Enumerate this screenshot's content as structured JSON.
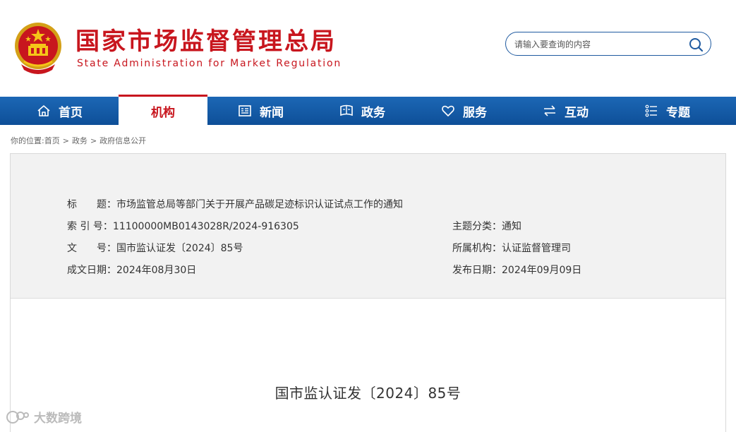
{
  "header": {
    "title": "国家市场监督管理总局",
    "subtitle": "State Administration for Market Regulation",
    "search_placeholder": "请输入要查询的内容"
  },
  "nav": {
    "items": [
      {
        "label": "首页",
        "icon": "home-icon"
      },
      {
        "label": "机构",
        "icon": "",
        "active": true
      },
      {
        "label": "新闻",
        "icon": "news-icon"
      },
      {
        "label": "政务",
        "icon": "government-affairs-icon"
      },
      {
        "label": "服务",
        "icon": "heart-icon"
      },
      {
        "label": "互动",
        "icon": "exchange-arrows-icon"
      },
      {
        "label": "专题",
        "icon": "topic-list-icon"
      }
    ]
  },
  "breadcrumb": {
    "prefix": "你的位置:",
    "items": [
      "首页",
      "政务",
      "政府信息公开"
    ],
    "separator": ">"
  },
  "document_meta": {
    "title_label": "标　　题：",
    "title_value": "市场监管总局等部门关于开展产品碳足迹标识认证试点工作的通知",
    "index_label": "索 引 号：",
    "index_value": "11100000MB0143028R/2024-916305",
    "category_label": "主题分类：",
    "category_value": "通知",
    "doc_no_label": "文　　号：",
    "doc_no_value": "国市监认证发〔2024〕85号",
    "agency_label": "所属机构：",
    "agency_value": "认证监督管理司",
    "created_label": "成文日期：",
    "created_value": "2024年08月30日",
    "published_label": "发布日期：",
    "published_value": "2024年09月09日"
  },
  "document_body": {
    "doc_number": "国市监认证发〔2024〕85号"
  },
  "watermark": {
    "text": "大数跨境"
  },
  "colors": {
    "brand_red": "#c8161e",
    "nav_blue": "#1467b3",
    "meta_bg": "#f2f2f2"
  }
}
